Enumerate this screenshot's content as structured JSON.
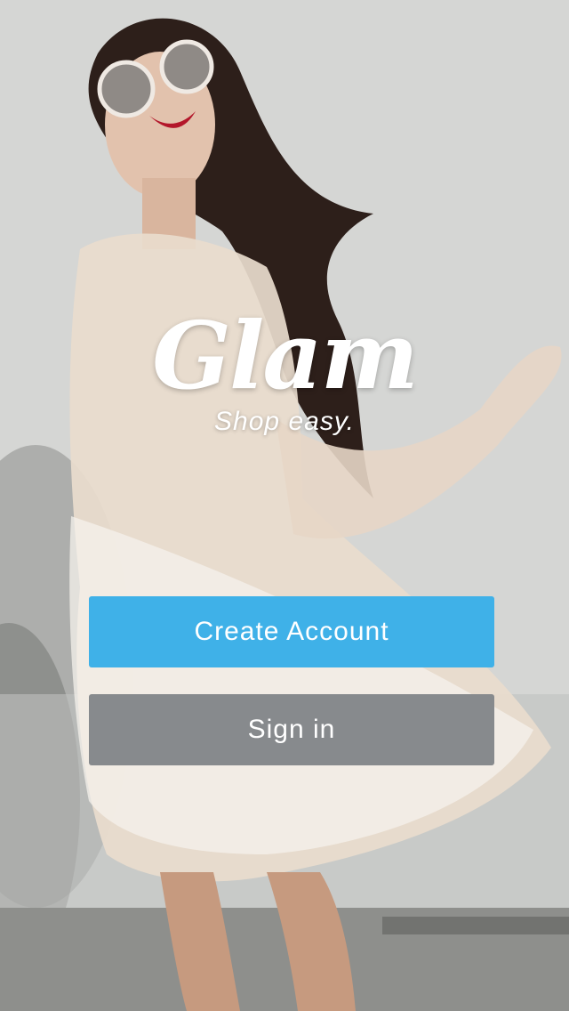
{
  "app": {
    "logo_text": "Glam",
    "tagline": "Shop easy."
  },
  "actions": {
    "create_account_label": "Create Account",
    "sign_in_label": "Sign in"
  },
  "colors": {
    "primary_button": "#3fb1e8",
    "secondary_button": "#878a8d",
    "text": "#ffffff"
  }
}
